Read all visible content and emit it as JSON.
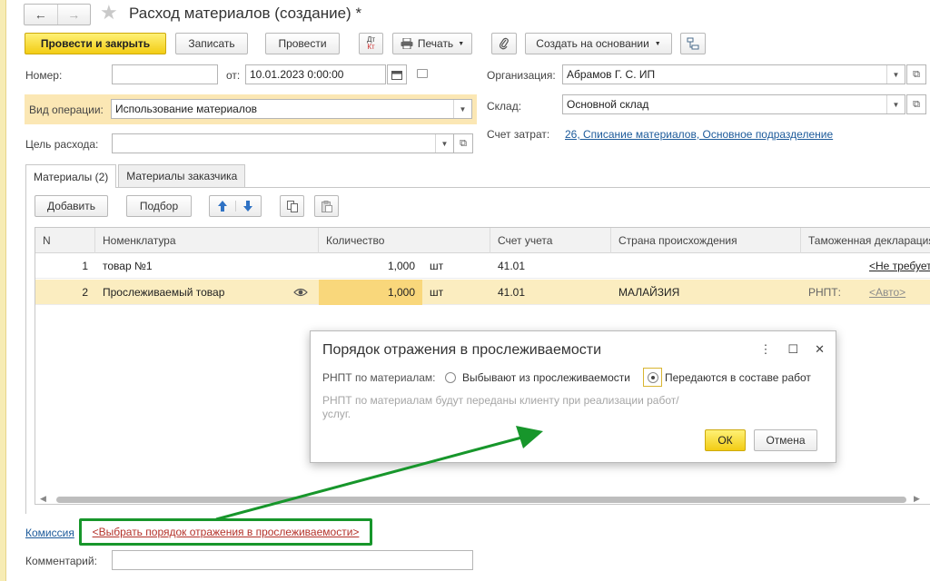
{
  "window": {
    "title": "Расход материалов (создание) *",
    "back_glyph": "←",
    "forward_glyph": "→"
  },
  "toolbar": {
    "post_close": "Провести и закрыть",
    "write": "Записать",
    "post": "Провести",
    "dtkt_top": "Дт",
    "dtkt_bottom": "Кт",
    "print": "Печать",
    "create_based": "Создать на основании"
  },
  "header": {
    "number_label": "Номер:",
    "number_value": "",
    "date_label": "от:",
    "date_value": "10.01.2023  0:00:00",
    "org_label": "Организация:",
    "org_value": "Абрамов Г. С. ИП",
    "optype_label": "Вид операции:",
    "optype_value": "Использование материалов",
    "warehouse_label": "Склад:",
    "warehouse_value": "Основной склад",
    "purpose_label": "Цель расхода:",
    "purpose_value": "",
    "cost_account_label": "Счет затрат:",
    "cost_account_value": "26, Списание материалов, Основное подразделение"
  },
  "tabs": [
    {
      "label": "Материалы (2)",
      "active": true
    },
    {
      "label": "Материалы заказчика",
      "active": false
    }
  ],
  "table_toolbar": {
    "add": "Добавить",
    "pick": "Подбор"
  },
  "table": {
    "columns": [
      "N",
      "Номенклатура",
      "Количество",
      "Счет учета",
      "Страна происхождения",
      "Таможенная декларация"
    ],
    "rows": [
      {
        "n": "1",
        "item": "товар №1",
        "qty": "1,000",
        "unit": "шт",
        "account": "41.01",
        "country": "",
        "customs_prefix": "",
        "customs": "<Не требуется>",
        "selected": false
      },
      {
        "n": "2",
        "item": "Прослеживаемый товар",
        "qty": "1,000",
        "unit": "шт",
        "account": "41.01",
        "country": "МАЛАЙЗИЯ",
        "customs_prefix": "РНПТ:",
        "customs": "<Авто>",
        "selected": true
      }
    ]
  },
  "dialog": {
    "title": "Порядок отражения в прослеживаемости",
    "rnpt_label": "РНПТ по материалам:",
    "option_1": "Выбывают из прослеживаемости",
    "option_2": "Передаются в составе работ",
    "selected_option": 2,
    "hint": "РНПТ по материалам будут переданы клиенту при реализации работ/услуг.",
    "ok": "ОК",
    "cancel": "Отмена"
  },
  "footer": {
    "commission_link": "Комиссия",
    "traceability_link": "<Выбрать порядок отражения в прослеживаемости>",
    "comment_label": "Комментарий:",
    "comment_value": ""
  },
  "colors": {
    "primary_button": "#f2cc14",
    "selected_row": "#fbedc0",
    "highlight_arrow": "#17962b",
    "link": "#1c5a9a",
    "traceability_link": "#b4322a"
  },
  "icons": {
    "favorite": "star-icon",
    "print": "printer-icon",
    "attach": "paperclip-icon",
    "structure": "structure-icon",
    "calendar": "calendar-icon",
    "traceable": "eye-icon"
  }
}
